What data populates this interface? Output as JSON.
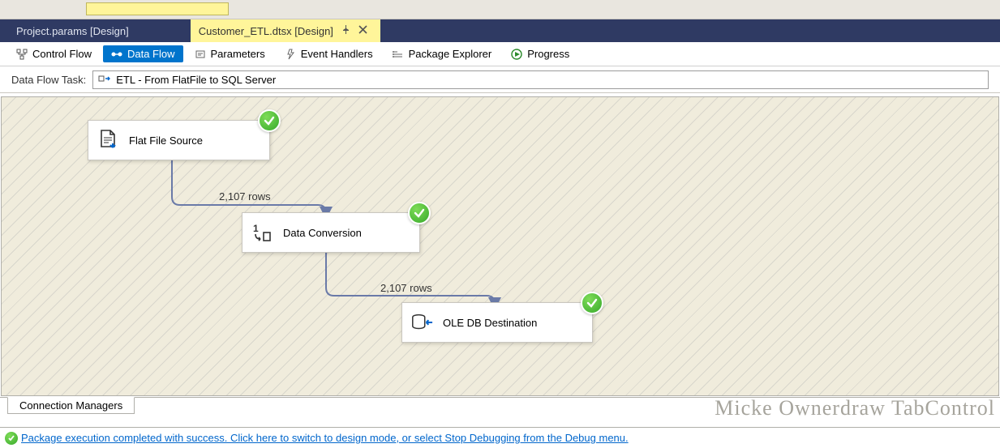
{
  "doc_tabs": {
    "inactive": "Project.params [Design]",
    "active": "Customer_ETL.dtsx [Design]"
  },
  "inner_tabs": {
    "control_flow": "Control Flow",
    "data_flow": "Data Flow",
    "parameters": "Parameters",
    "event_handlers": "Event Handlers",
    "package_explorer": "Package Explorer",
    "progress": "Progress"
  },
  "task": {
    "label": "Data Flow Task:",
    "value": "ETL - From FlatFile to SQL Server"
  },
  "nodes": {
    "source": "Flat File Source",
    "conv": "Data Conversion",
    "dest": "OLE DB Destination"
  },
  "rowcounts": {
    "a": "2,107 rows",
    "b": "2,107 rows"
  },
  "conn_mgr_tab": "Connection Managers",
  "watermark": "Micke Ownerdraw TabControl",
  "status_msg": "Package execution completed with success. Click here to switch to design mode, or select Stop Debugging from the Debug menu."
}
